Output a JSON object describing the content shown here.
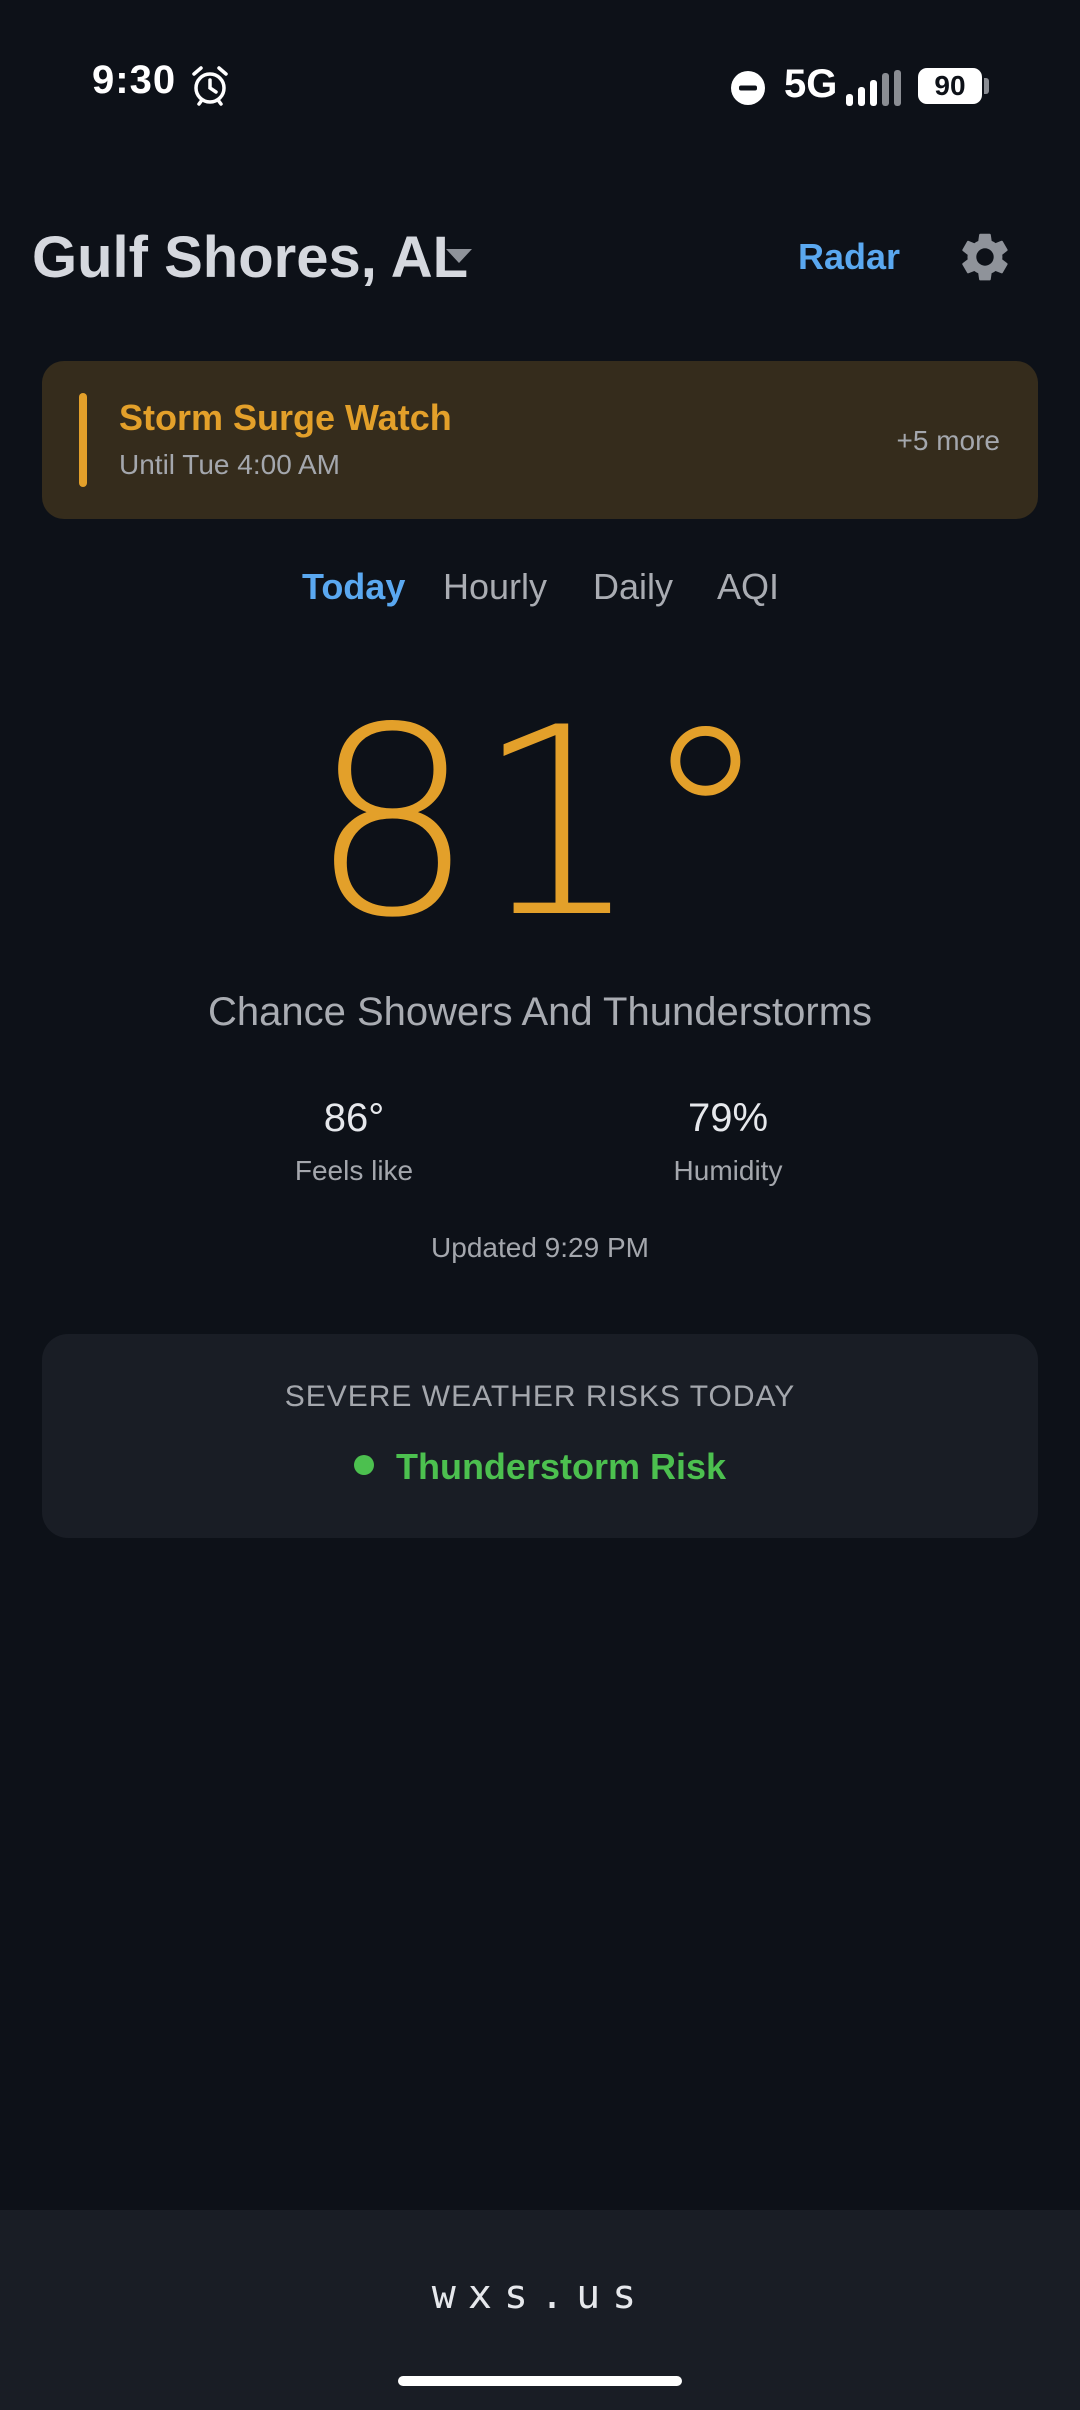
{
  "status_bar": {
    "time": "9:30",
    "network": "5G",
    "battery": "90",
    "icons": [
      "alarm-clock-icon",
      "do-not-disturb-icon",
      "cell-signal-icon",
      "battery-icon"
    ]
  },
  "header": {
    "location": "Gulf Shores, AL",
    "radar_label": "Radar",
    "icons": [
      "caret-down-icon",
      "gear-icon"
    ]
  },
  "alert": {
    "title": "Storm Surge Watch",
    "subtitle": "Until Tue 4:00 AM",
    "more": "+5 more"
  },
  "tabs": [
    {
      "label": "Today",
      "active": true
    },
    {
      "label": "Hourly",
      "active": false
    },
    {
      "label": "Daily",
      "active": false
    },
    {
      "label": "AQI",
      "active": false
    }
  ],
  "current": {
    "temperature": "81°",
    "condition": "Chance Showers And Thunderstorms",
    "feels_like_value": "86°",
    "feels_like_label": "Feels like",
    "humidity_value": "79%",
    "humidity_label": "Humidity",
    "updated": "Updated 9:29 PM"
  },
  "severe": {
    "title": "SEVERE WEATHER RISKS TODAY",
    "item": "Thunderstorm Risk",
    "item_color": "#4cc04f"
  },
  "footer": {
    "brand": "wxs.us"
  },
  "colors": {
    "background": "#0d1118",
    "accent_blue": "#5aa8f0",
    "accent_amber": "#e3a02a",
    "risk_green": "#4cc04f"
  }
}
